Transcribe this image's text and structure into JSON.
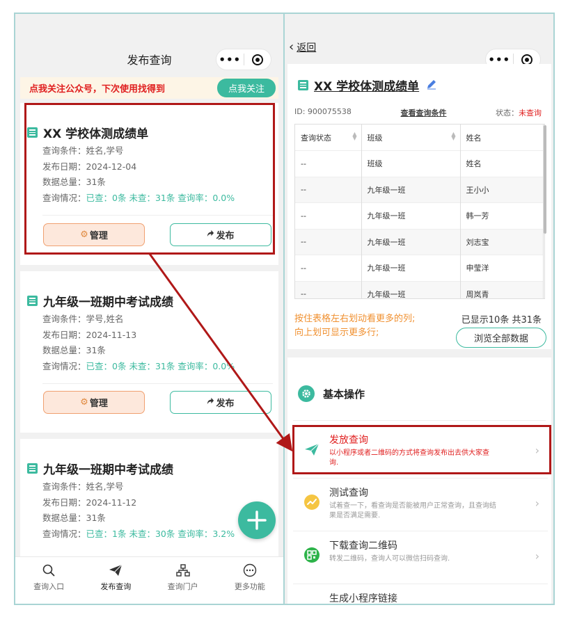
{
  "left": {
    "nav_title": "发布查询",
    "capsule": {
      "more": "•••"
    },
    "follow_bar": {
      "text": "点我关注公众号，下次使用找得到",
      "button": "点我关注"
    },
    "cards": [
      {
        "title": "XX 学校体测成绩单",
        "condition": "查询条件：姓名,学号",
        "date": "发布日期：2024-12-04",
        "total": "数据总量：31条",
        "status_label": "查询情况：",
        "status_value": "已查：0条 未查：31条 查询率：0.0%",
        "manage": "管理",
        "publish": "发布"
      },
      {
        "title": "九年级一班期中考试成绩",
        "condition": "查询条件：学号,姓名",
        "date": "发布日期：2024-11-13",
        "total": "数据总量：31条",
        "status_label": "查询情况：",
        "status_value": "已查：0条 未查：31条 查询率：0.0%",
        "manage": "管理",
        "publish": "发布"
      },
      {
        "title": "九年级一班期中考试成绩",
        "condition": "查询条件：姓名,学号",
        "date": "发布日期：2024-11-12",
        "total": "数据总量：31条",
        "status_label": "查询情况：",
        "status_value": "已查：1条 未查：30条 查询率：3.2%"
      }
    ],
    "tabs": [
      {
        "label": "查询入口",
        "icon": "search-icon"
      },
      {
        "label": "发布查询",
        "icon": "paper-plane-icon"
      },
      {
        "label": "查询门户",
        "icon": "sitemap-icon"
      },
      {
        "label": "更多功能",
        "icon": "more-circle-icon"
      }
    ]
  },
  "right": {
    "back": "返回",
    "title": "XX 学校体测成绩单",
    "id_text": "ID: 900075538",
    "view_conditions": "查看查询条件",
    "status_label": "状态：",
    "status_value": "未查询",
    "table": {
      "headers": [
        "查询状态",
        "班级",
        "姓名"
      ],
      "rows": [
        [
          "--",
          "班级",
          "姓名"
        ],
        [
          "--",
          "九年级一班",
          "王小小"
        ],
        [
          "--",
          "九年级一班",
          "韩一芳"
        ],
        [
          "--",
          "九年级一班",
          "刘志宝"
        ],
        [
          "--",
          "九年级一班",
          "申莹洋"
        ],
        [
          "--",
          "九年级一班",
          "周岚青"
        ]
      ]
    },
    "hint_line1": "按住表格左右划动看更多的列;",
    "hint_line2": "向上划可显示更多行;",
    "count": "已显示10条 共31条",
    "browse_all": "浏览全部数据",
    "ops_title": "基本操作",
    "ops": [
      {
        "title": "发放查询",
        "desc": "以小程序或者二维码的方式将查询发布出去供大家查询.",
        "icon": "paper-plane-icon"
      },
      {
        "title": "测试查询",
        "desc": "试着查一下，看查询是否能被用户正常查询，且查询结果是否满足需要.",
        "icon": "trend-icon"
      },
      {
        "title": "下载查询二维码",
        "desc": "转发二维码，查询人可以微信扫码查询.",
        "icon": "qrcode-icon"
      },
      {
        "title": "生成小程序链接",
        "desc": "",
        "icon": "link-icon"
      }
    ]
  },
  "colors": {
    "accent": "#3cba9f",
    "alert_red": "#e02020",
    "highlight_border": "#b01818",
    "hint_orange": "#f09030"
  }
}
